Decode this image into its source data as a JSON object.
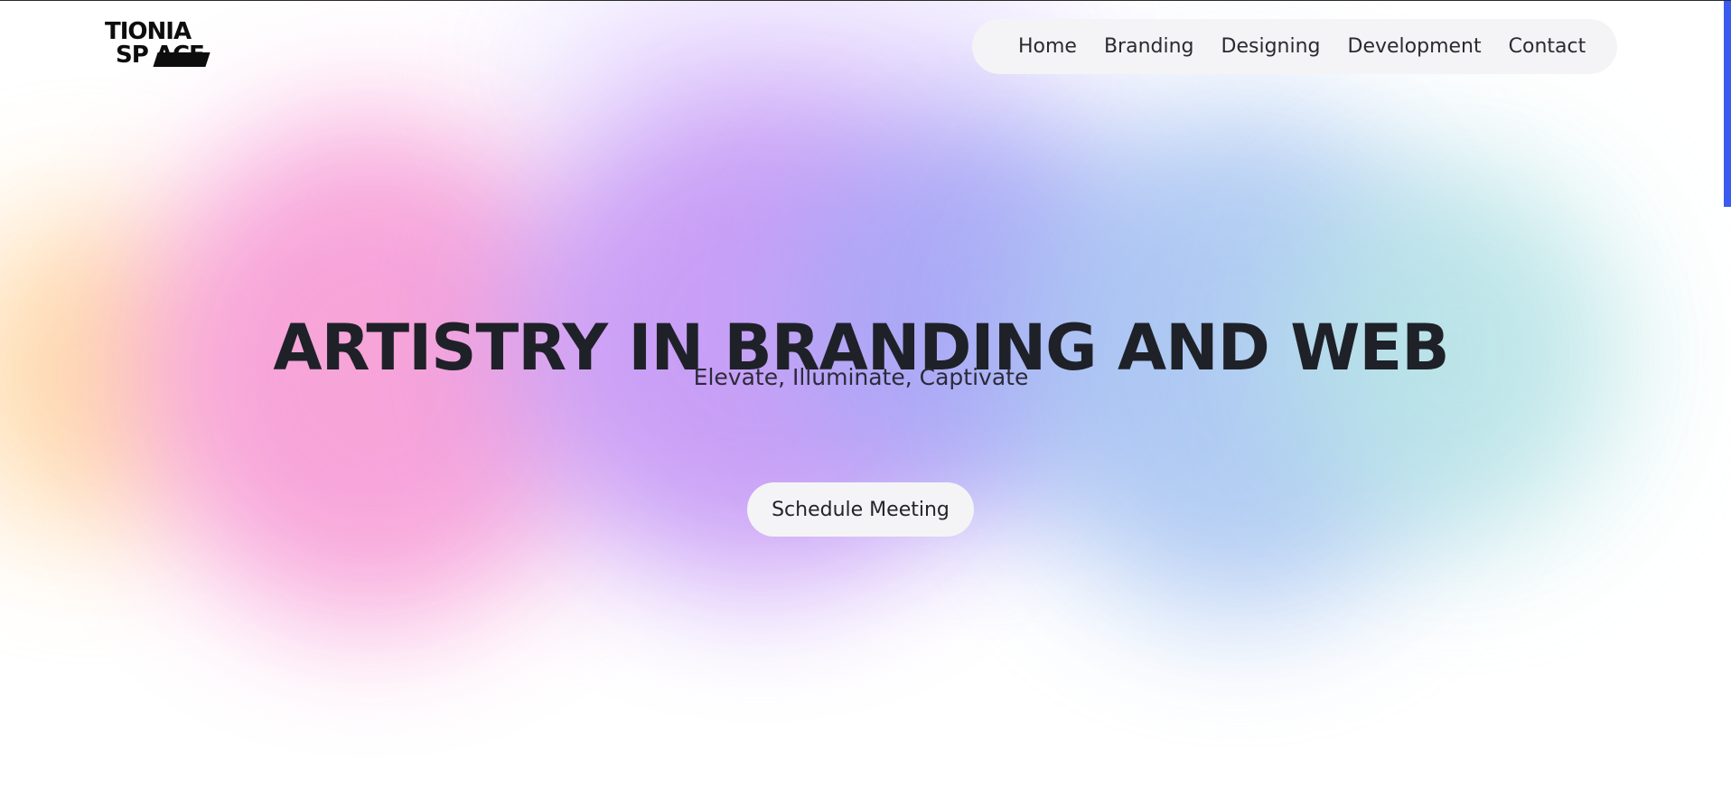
{
  "brand": {
    "logo_line1": "TIONIA",
    "logo_line2": "SP   ACE",
    "colors": {
      "text": "#1f2128",
      "nav_bg": "#f4f4f6",
      "scrollbar": "#3b5bf0",
      "gradient": [
        "#ffd9a8",
        "#f7a0d8",
        "#c79bf6",
        "#a7a9f6",
        "#a9c6f2",
        "#b7e4e6"
      ]
    }
  },
  "nav": {
    "items": [
      {
        "label": "Home"
      },
      {
        "label": "Branding"
      },
      {
        "label": "Designing"
      },
      {
        "label": "Development"
      },
      {
        "label": "Contact"
      }
    ]
  },
  "hero": {
    "title": "ARTISTRY IN BRANDING AND WEB",
    "subtitle": "Elevate, Illuminate, Captivate",
    "cta_label": "Schedule Meeting"
  }
}
